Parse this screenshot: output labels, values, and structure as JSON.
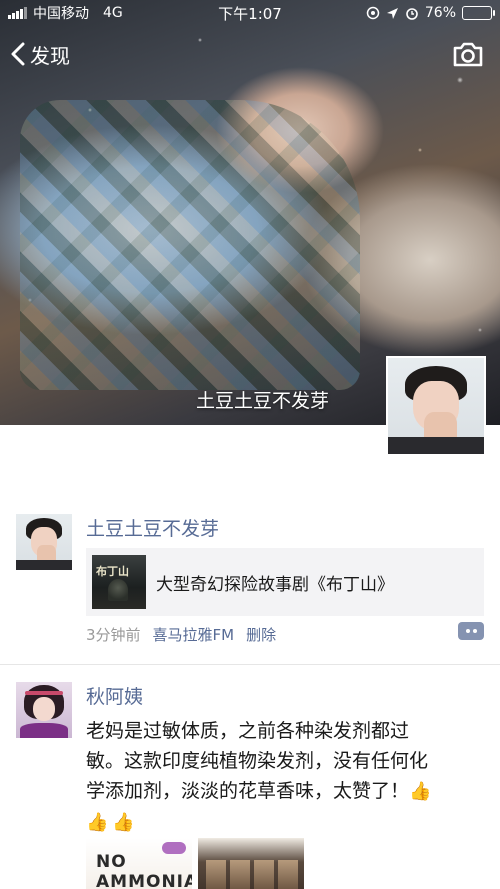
{
  "status_bar": {
    "carrier": "中国移动",
    "network": "4G",
    "time": "下午1:07",
    "battery_percent": "76%",
    "battery_level": 0.76
  },
  "nav": {
    "back_label": "发现"
  },
  "cover": {
    "name": "土豆土豆不发芽"
  },
  "posts": [
    {
      "author": "土豆土豆不发芽",
      "share": {
        "thumb_text": "布丁山",
        "title": "大型奇幻探险故事剧《布丁山》"
      },
      "time": "3分钟前",
      "source": "喜马拉雅FM",
      "delete_label": "删除"
    },
    {
      "author": "秋阿姨",
      "text_line1": "老妈是过敏体质，之前各种染发剂都过",
      "text_line2": "敏。这款印度纯植物染发剂，没有任何化",
      "text_line3": "学添加剂，淡淡的花草香味，太赞了！",
      "image_text": "NO AMMONIA"
    }
  ]
}
